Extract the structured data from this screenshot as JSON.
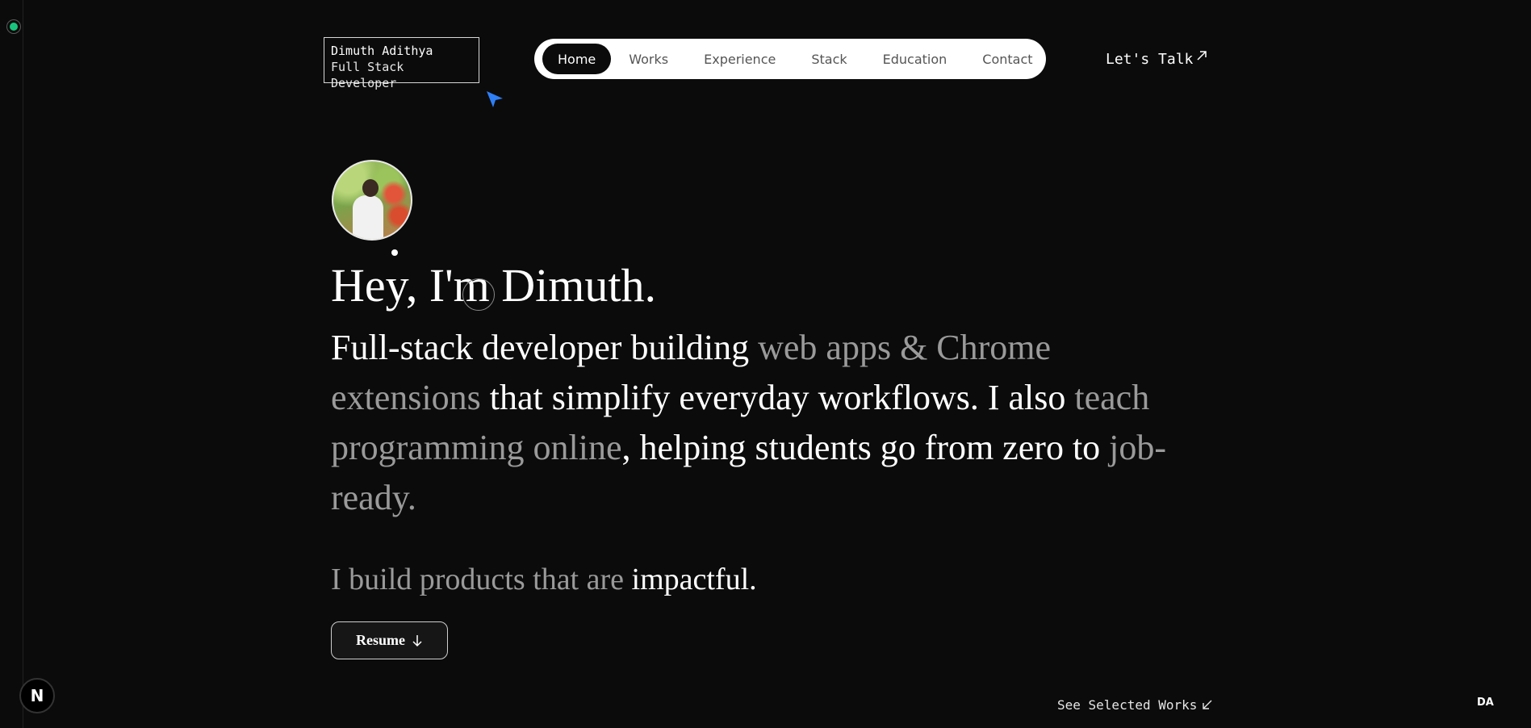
{
  "brand": {
    "name": "Dimuth Adithya",
    "role": "Full Stack Developer"
  },
  "nav": {
    "items": [
      {
        "label": "Home",
        "active": true
      },
      {
        "label": "Works",
        "active": false
      },
      {
        "label": "Experience",
        "active": false
      },
      {
        "label": "Stack",
        "active": false
      },
      {
        "label": "Education",
        "active": false
      },
      {
        "label": "Contact",
        "active": false
      }
    ]
  },
  "header": {
    "cta_label": "Let's Talk"
  },
  "hero": {
    "title": "Hey, I'm Dimuth.",
    "desc_parts": [
      {
        "text": "Full-stack developer building ",
        "muted": false
      },
      {
        "text": "web apps & Chrome extensions",
        "muted": true
      },
      {
        "text": " that simplify everyday workflows. I also ",
        "muted": false
      },
      {
        "text": "teach programming online",
        "muted": true
      },
      {
        "text": ", helping students go from zero to ",
        "muted": false
      },
      {
        "text": "job-ready.",
        "muted": true
      }
    ],
    "tagline_prefix": "I build products that are ",
    "tagline_highlight": "impactful.",
    "resume_label": "Resume"
  },
  "footer": {
    "badge_letter": "N",
    "see_works_label": "See Selected Works",
    "initials": "DA"
  },
  "colors": {
    "background": "#0b0b0b",
    "text": "#ffffff",
    "muted_text": "#9a9a9a",
    "status_green": "#19c37d",
    "pointer_blue": "#2f7ff6"
  },
  "icons": [
    "status-dot-icon",
    "pointer-icon",
    "arrow-up-right-icon",
    "arrow-down-icon",
    "arrow-down-left-icon",
    "avatar",
    "cursor-ring-icon"
  ]
}
